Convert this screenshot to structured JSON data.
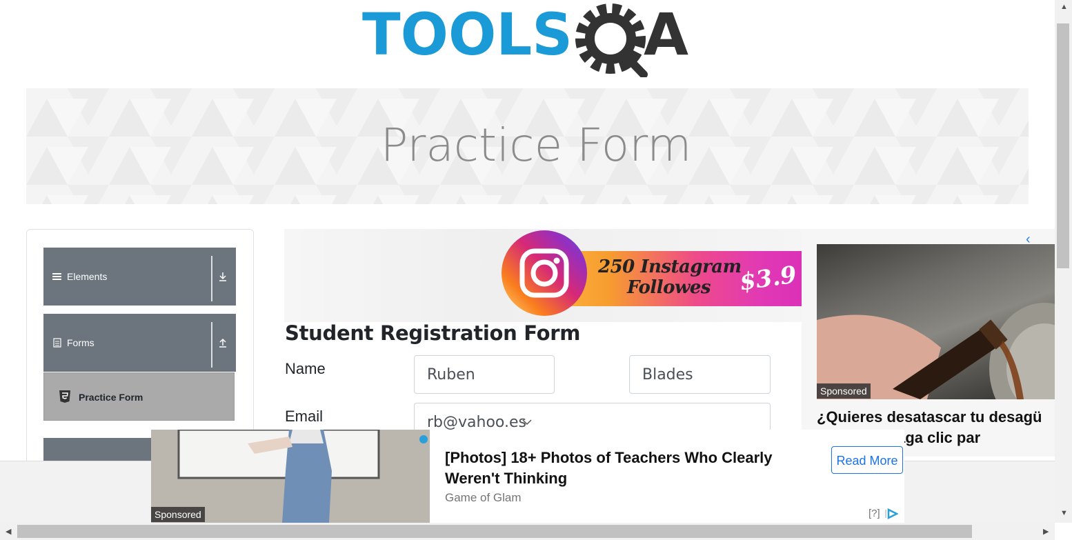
{
  "logo": {
    "text": "TOOLSQA",
    "tools_text": "TOOLS",
    "qa_text": "A",
    "color_blue": "#1a9ad6",
    "color_dark": "#333333"
  },
  "banner": {
    "title": "Practice Form"
  },
  "sidebar": {
    "groups": [
      {
        "label": "Elements",
        "icon": "hamburger-icon",
        "arrow": "download-arrow-icon"
      },
      {
        "label": "Forms",
        "icon": "document-icon",
        "arrow": "upload-arrow-icon"
      }
    ],
    "active_item": {
      "label": "Practice Form",
      "icon": "html5-icon"
    }
  },
  "insta_ad": {
    "line1": "250 Instagram",
    "line2": "Followes",
    "price": "$3.9"
  },
  "form": {
    "title": "Student Registration Form",
    "name_label": "Name",
    "first_name": "Ruben",
    "last_name": "Blades",
    "email_label": "Email",
    "email": "rb@vahoo.es"
  },
  "right_ad": {
    "sponsored": "Sponsored",
    "headline": "¿Quieres desatascar tu desagü",
    "headline_line2": "minuto? (Haga clic par"
  },
  "bottom_ad": {
    "sponsored": "Sponsored",
    "headline": "[Photos] 18+ Photos of Teachers Who Clearly Weren't Thinking",
    "source": "Game of Glam",
    "cta": "Read More",
    "adchoices": "[?]"
  }
}
